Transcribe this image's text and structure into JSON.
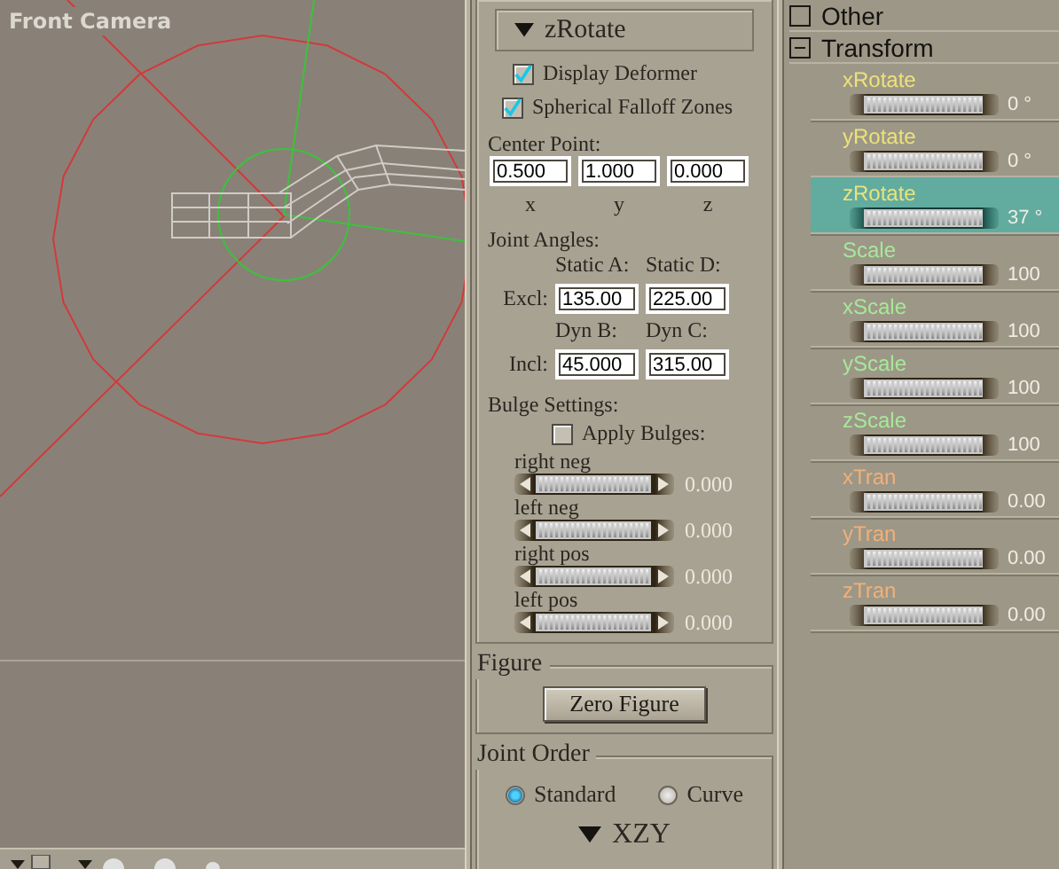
{
  "viewport": {
    "title": "Front Camera"
  },
  "deformer": {
    "title": "zRotate",
    "options": [
      {
        "label": "Display Deformer",
        "checked": true
      },
      {
        "label": "Spherical Falloff Zones",
        "checked": true
      }
    ],
    "center_point": {
      "label": "Center Point:",
      "fields": [
        {
          "value": "0.500",
          "axis": "x"
        },
        {
          "value": "1.000",
          "axis": "y"
        },
        {
          "value": "0.000",
          "axis": "z"
        }
      ]
    },
    "joint_angles": {
      "label": "Joint Angles:",
      "rows": [
        {
          "label": "Excl:",
          "fields": [
            {
              "heading": "Static A:",
              "value": "135.00"
            },
            {
              "heading": "Static D:",
              "value": "225.00"
            }
          ]
        },
        {
          "label": "Incl:",
          "fields": [
            {
              "heading": "Dyn B:",
              "value": "45.000"
            },
            {
              "heading": "Dyn C:",
              "value": "315.00"
            }
          ]
        }
      ]
    },
    "bulge": {
      "label": "Bulge Settings:",
      "apply": {
        "label": "Apply Bulges:",
        "checked": false
      },
      "dials": [
        {
          "label": "right neg",
          "value": "0.000"
        },
        {
          "label": "left neg",
          "value": "0.000"
        },
        {
          "label": "right pos",
          "value": "0.000"
        },
        {
          "label": "left pos",
          "value": "0.000"
        }
      ]
    }
  },
  "figure": {
    "title": "Figure",
    "button": "Zero Figure"
  },
  "joint_order": {
    "title": "Joint Order",
    "options": [
      {
        "label": "Standard",
        "selected": true
      },
      {
        "label": "Curve",
        "selected": false
      }
    ],
    "order": "XZY"
  },
  "parameters": {
    "groups": [
      {
        "label": "Other"
      },
      {
        "label": "Transform",
        "expanded": true
      }
    ],
    "items": [
      {
        "label": "xRotate",
        "value": "0 °",
        "color": "#ece27a",
        "selected": false
      },
      {
        "label": "yRotate",
        "value": "0 °",
        "color": "#ece27a",
        "selected": false
      },
      {
        "label": "zRotate",
        "value": "37 °",
        "color": "#ece27a",
        "selected": true
      },
      {
        "label": "Scale",
        "value": "100",
        "color": "#a6e89a",
        "selected": false
      },
      {
        "label": "xScale",
        "value": "100",
        "color": "#a6e89a",
        "selected": false
      },
      {
        "label": "yScale",
        "value": "100",
        "color": "#a6e89a",
        "selected": false
      },
      {
        "label": "zScale",
        "value": "100",
        "color": "#a6e89a",
        "selected": false
      },
      {
        "label": "xTran",
        "value": "0.00",
        "color": "#f2b078",
        "selected": false
      },
      {
        "label": "yTran",
        "value": "0.00",
        "color": "#f2b078",
        "selected": false
      },
      {
        "label": "zTran",
        "value": "0.00",
        "color": "#f2b078",
        "selected": false
      }
    ]
  }
}
